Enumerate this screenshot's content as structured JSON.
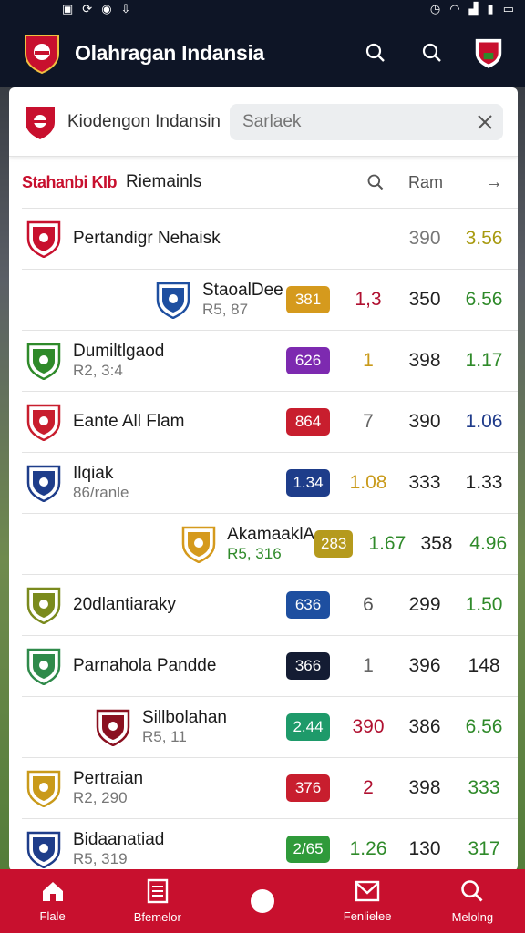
{
  "app": {
    "title": "Olahragan Indansia"
  },
  "search": {
    "brand": "Kiodengon Indansin",
    "placeholder": "Sarlaek"
  },
  "list_header": {
    "tag": "Stahanbi KIb",
    "label": "Riemainls",
    "col_label": "Ram"
  },
  "rows": [
    {
      "name": "Pertandigr Nehaisk",
      "sub": "",
      "badge": "",
      "badge_color": "",
      "v1": "",
      "v1_color": "#222222",
      "v2": "390",
      "v2_color": "#777777",
      "v3": "3.56",
      "v3_color": "#a89a10",
      "highlight": ""
    },
    {
      "name": "StaoalDee",
      "sub": "R5, 87",
      "badge": "381",
      "badge_color": "#d59a1d",
      "v1": "1,3",
      "v1_color": "#b01030",
      "v2": "350",
      "v2_color": "#222222",
      "v3": "6.56",
      "v3_color": "#2f8a2a",
      "highlight": "right2"
    },
    {
      "name": "Dumiltlgaod",
      "sub": "R2, 3:4",
      "badge": "626",
      "badge_color": "#7d2ab0",
      "v1": "1",
      "v1_color": "#c99a1a",
      "v2": "398",
      "v2_color": "#222222",
      "v3": "1.17",
      "v3_color": "#2f8a2a",
      "highlight": ""
    },
    {
      "name": "Eante All Flam",
      "sub": "",
      "badge": "864",
      "badge_color": "#c81e2e",
      "v1": "7",
      "v1_color": "#666666",
      "v2": "390",
      "v2_color": "#222222",
      "v3": "1.06",
      "v3_color": "#1f3b8a",
      "highlight": ""
    },
    {
      "name": "Ilqiak",
      "sub": "86/ranle",
      "badge": "1.34",
      "badge_color": "#1e3d8a",
      "v1": "1.08",
      "v1_color": "#c99a1a",
      "v2": "333",
      "v2_color": "#222222",
      "v3": "1.33",
      "v3_color": "#222222",
      "highlight": ""
    },
    {
      "name": "AkamaaklA",
      "sub": "R5, 316",
      "sub_color": "#2f8a2a",
      "badge": "283",
      "badge_color": "#b59a1d",
      "v1": "1.67",
      "v1_color": "#2f8a2a",
      "v2": "358",
      "v2_color": "#222222",
      "v3": "4.96",
      "v3_color": "#2f8a2a",
      "highlight": "right3"
    },
    {
      "name": "20dlantiaraky",
      "sub": "",
      "badge": "636",
      "badge_color": "#1e4fa0",
      "v1": "6",
      "v1_color": "#555555",
      "v2": "299",
      "v2_color": "#222222",
      "v3": "1.50",
      "v3_color": "#2f8a2a",
      "highlight": ""
    },
    {
      "name": "Parnahola Pandde",
      "sub": "",
      "badge": "366",
      "badge_color": "#141c33",
      "v1": "1",
      "v1_color": "#666666",
      "v2": "396",
      "v2_color": "#222222",
      "v3": "148",
      "v3_color": "#222222",
      "highlight": ""
    },
    {
      "name": "Sillbolahan",
      "sub": "R5, 11",
      "badge": "2.44",
      "badge_color": "#1e9a6a",
      "v1": "390",
      "v1_color": "#b01030",
      "v2": "386",
      "v2_color": "#222222",
      "v3": "6.56",
      "v3_color": "#2f8a2a",
      "highlight": "right1"
    },
    {
      "name": "Pertraian",
      "sub": "R2, 290",
      "badge": "376",
      "badge_color": "#c81e2e",
      "v1": "2",
      "v1_color": "#b01030",
      "v2": "398",
      "v2_color": "#222222",
      "v3": "333",
      "v3_color": "#2f8a2a",
      "highlight": ""
    },
    {
      "name": "Bidaanatiad",
      "sub": "R5, 319",
      "badge": "2/65",
      "badge_color": "#2f9a3a",
      "v1": "1.26",
      "v1_color": "#2f8a2a",
      "v2": "130",
      "v2_color": "#222222",
      "v3": "317",
      "v3_color": "#2f8a2a",
      "highlight": ""
    }
  ],
  "nav": [
    {
      "label": "Flale",
      "icon": "home-icon"
    },
    {
      "label": "Bfemelor",
      "icon": "document-icon"
    },
    {
      "label": "",
      "icon": "center-dot-icon"
    },
    {
      "label": "Fenlielee",
      "icon": "mail-icon"
    },
    {
      "label": "Melolng",
      "icon": "search-icon"
    }
  ],
  "colors": {
    "primary": "#c8102e",
    "appbar": "#0e1526",
    "highlight": "#b8e6a0"
  }
}
